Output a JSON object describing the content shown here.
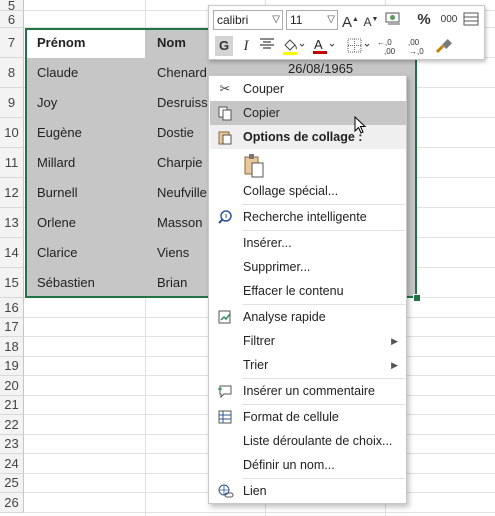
{
  "rows": [
    "5",
    "6",
    "7",
    "8",
    "9",
    "10",
    "11",
    "12",
    "13",
    "14",
    "15",
    "16",
    "17",
    "18",
    "19",
    "20",
    "21",
    "22",
    "23",
    "24",
    "25",
    "26"
  ],
  "headers": {
    "prenom": "Prénom",
    "nom": "Nom"
  },
  "data_rows": [
    {
      "prenom": "Claude",
      "nom": "Chenard",
      "date": "26/08/1965"
    },
    {
      "prenom": "Joy",
      "nom": "Desruisseaux",
      "date": ""
    },
    {
      "prenom": "Eugène",
      "nom": "Dostie",
      "date": ""
    },
    {
      "prenom": "Millard",
      "nom": "Charpie",
      "date": ""
    },
    {
      "prenom": "Burnell",
      "nom": "Neufville",
      "date": ""
    },
    {
      "prenom": "Orlene",
      "nom": "Masson",
      "date": ""
    },
    {
      "prenom": "Clarice",
      "nom": "Viens",
      "date": ""
    },
    {
      "prenom": "Sébastien",
      "nom": "Brian",
      "date": ""
    }
  ],
  "mini_toolbar": {
    "font_name": "calibri",
    "font_size": "11",
    "grow_font": "A",
    "shrink_font": "A",
    "percent": "%",
    "thousands": "000",
    "bold": "G",
    "italic": "I",
    "font_color_letter": "A",
    "inc_decimal": "←,0 ,00",
    "dec_decimal": ",00 →,0"
  },
  "context_menu": {
    "cut": "Couper",
    "copy": "Copier",
    "paste_options": "Options de collage :",
    "paste_special": "Collage spécial...",
    "smart_lookup": "Recherche intelligente",
    "insert": "Insérer...",
    "delete": "Supprimer...",
    "clear": "Effacer le contenu",
    "quick_analysis": "Analyse rapide",
    "filter": "Filtrer",
    "sort": "Trier",
    "insert_comment": "Insérer un commentaire",
    "format_cells": "Format de cellule",
    "dropdown_list": "Liste déroulante de choix...",
    "define_name": "Définir un nom...",
    "link": "Lien"
  },
  "colors": {
    "selection_border": "#217346",
    "highlight": "#c6c6c6"
  }
}
